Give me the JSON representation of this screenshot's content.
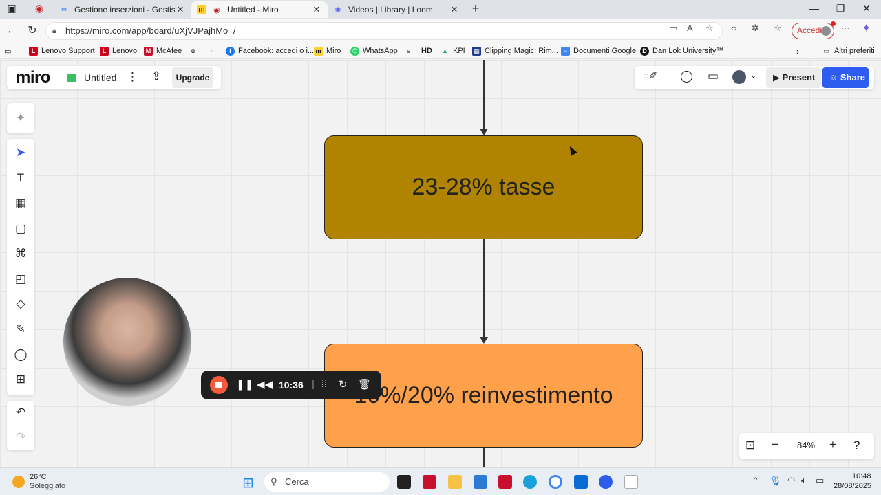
{
  "browser": {
    "tabs": [
      {
        "label": "Gestione inserzioni - Gestisci inse"
      },
      {
        "label": "Untitled - Miro"
      },
      {
        "label": "Videos | Library | Loom"
      }
    ],
    "url": "https://miro.com/app/board/uXjVJPajhMo=/",
    "accedi": "Accedi",
    "bookmarks": [
      "Lenovo Support",
      "Lenovo",
      "McAfee",
      "Facebook: accedi o i...",
      "Miro",
      "WhatsApp",
      "HD",
      "KPI",
      "Clipping Magic: Rim...",
      "Documenti Google",
      "Dan Lok University™",
      "Altri preferiti"
    ]
  },
  "miro": {
    "logo": "miro",
    "board_name": "Untitled",
    "upgrade": "Upgrade",
    "present": "Present",
    "share": "Share",
    "zoom": "84%"
  },
  "flow": {
    "box1": {
      "text": "23-28% tasse",
      "color": "#b08400"
    },
    "box2": {
      "text": "10%/20% reinvestimento",
      "color": "#ffa04a"
    }
  },
  "recorder": {
    "time": "10:36"
  },
  "taskbar": {
    "temperature": "26°C",
    "weather": "Soleggiato",
    "search_placeholder": "Cerca",
    "time": "10:48",
    "date": "28/08/2025"
  }
}
